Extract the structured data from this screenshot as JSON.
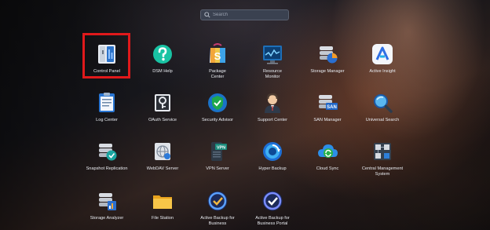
{
  "search": {
    "placeholder": "Search"
  },
  "apps": [
    {
      "id": "control-panel",
      "label": "Control Panel"
    },
    {
      "id": "dsm-help",
      "label": "DSM Help"
    },
    {
      "id": "package-center",
      "label": "Package\nCenter"
    },
    {
      "id": "resource-monitor",
      "label": "Resource\nMonitor"
    },
    {
      "id": "storage-manager",
      "label": "Storage Manager"
    },
    {
      "id": "active-insight",
      "label": "Active Insight"
    },
    {
      "id": "log-center",
      "label": "Log Center"
    },
    {
      "id": "oauth-service",
      "label": "OAuth Service"
    },
    {
      "id": "security-advisor",
      "label": "Security Advisor"
    },
    {
      "id": "support-center",
      "label": "Support Center"
    },
    {
      "id": "san-manager",
      "label": "SAN Manager"
    },
    {
      "id": "universal-search",
      "label": "Universal Search"
    },
    {
      "id": "snapshot-replication",
      "label": "Snapshot Replication"
    },
    {
      "id": "webdav-server",
      "label": "WebDAV Server"
    },
    {
      "id": "vpn-server",
      "label": "VPN Server"
    },
    {
      "id": "hyper-backup",
      "label": "Hyper Backup"
    },
    {
      "id": "cloud-sync",
      "label": "Cloud Sync"
    },
    {
      "id": "central-management-system",
      "label": "Central Management\nSystem"
    },
    {
      "id": "storage-analyzer",
      "label": "Storage Analyzer"
    },
    {
      "id": "file-station",
      "label": "File Station"
    },
    {
      "id": "active-backup-business",
      "label": "Active Backup for\nBusiness"
    },
    {
      "id": "active-backup-business-portal",
      "label": "Active Backup for\nBusiness Portal"
    }
  ],
  "icon_badges": {
    "san": "SAN",
    "vpn": "VPN"
  },
  "highlight_color": "#e0191b"
}
